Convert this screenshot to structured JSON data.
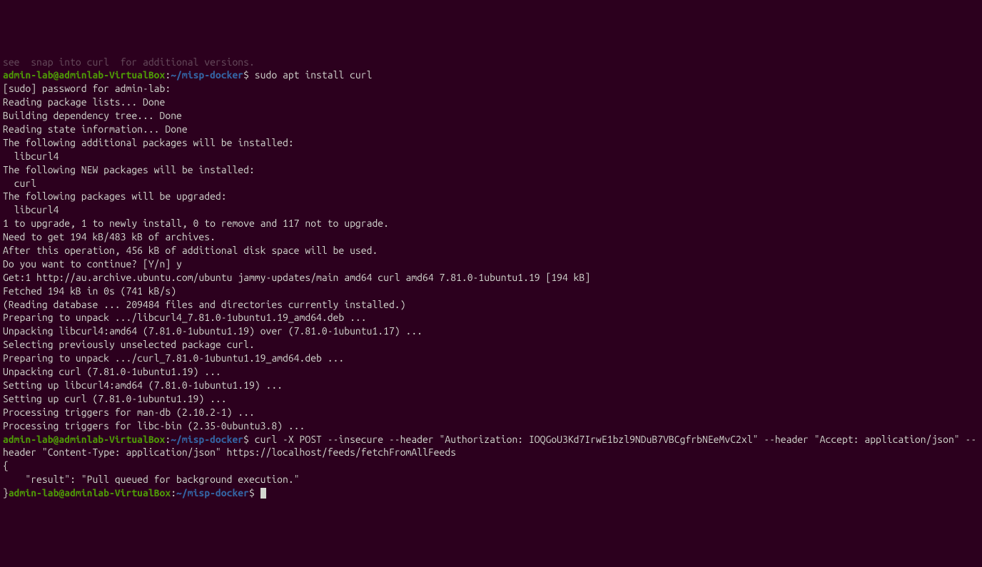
{
  "prompt": {
    "user_host": "admin-lab@adminlab-VirtualBox",
    "colon": ":",
    "path": "~/misp-docker",
    "dollar": "$"
  },
  "lines": {
    "partial_top": "see  snap into curl  for additional versions.",
    "cmd1": " sudo apt install curl",
    "l1": "[sudo] password for admin-lab:",
    "l2": "Reading package lists... Done",
    "l3": "Building dependency tree... Done",
    "l4": "Reading state information... Done",
    "l5": "The following additional packages will be installed:",
    "l6": "  libcurl4",
    "l7": "The following NEW packages will be installed:",
    "l8": "  curl",
    "l9": "The following packages will be upgraded:",
    "l10": "  libcurl4",
    "l11": "1 to upgrade, 1 to newly install, 0 to remove and 117 not to upgrade.",
    "l12": "Need to get 194 kB/483 kB of archives.",
    "l13": "After this operation, 456 kB of additional disk space will be used.",
    "l14": "Do you want to continue? [Y/n] y",
    "l15": "Get:1 http://au.archive.ubuntu.com/ubuntu jammy-updates/main amd64 curl amd64 7.81.0-1ubuntu1.19 [194 kB]",
    "l16": "Fetched 194 kB in 0s (741 kB/s)",
    "l17": "(Reading database ... 209484 files and directories currently installed.)",
    "l18": "Preparing to unpack .../libcurl4_7.81.0-1ubuntu1.19_amd64.deb ...",
    "l19": "Unpacking libcurl4:amd64 (7.81.0-1ubuntu1.19) over (7.81.0-1ubuntu1.17) ...",
    "l20": "Selecting previously unselected package curl.",
    "l21": "Preparing to unpack .../curl_7.81.0-1ubuntu1.19_amd64.deb ...",
    "l22": "Unpacking curl (7.81.0-1ubuntu1.19) ...",
    "l23": "Setting up libcurl4:amd64 (7.81.0-1ubuntu1.19) ...",
    "l24": "Setting up curl (7.81.0-1ubuntu1.19) ...",
    "l25": "Processing triggers for man-db (2.10.2-1) ...",
    "l26": "Processing triggers for libc-bin (2.35-0ubuntu3.8) ...",
    "cmd2": " curl -X POST --insecure --header \"Authorization: IOQGoU3Kd7IrwE1bzl9NDuB7VBCgfrbNEeMvC2xl\" --header \"Accept: application/json\" --header \"Content-Type: application/json\" https://localhost/feeds/fetchFromAllFeeds",
    "j1": "{",
    "j2": "    \"result\": \"Pull queued for background execution.\"",
    "j3_prefix": "}"
  }
}
